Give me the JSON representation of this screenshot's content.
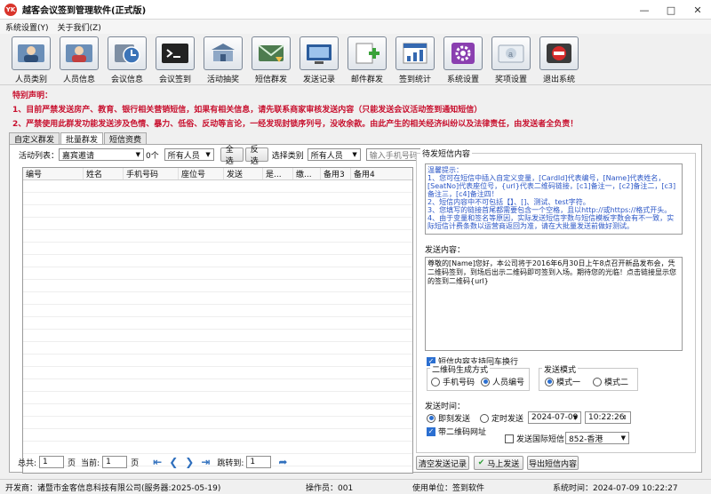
{
  "app": {
    "title": "越客会议签到管理软件(正式版)",
    "badge": "YK"
  },
  "menu": [
    "系统设置(Y)",
    "关于我们(Z)"
  ],
  "toolbar": [
    {
      "label": "人员类别",
      "icon": "people-category-icon"
    },
    {
      "label": "人员信息",
      "icon": "person-info-icon"
    },
    {
      "label": "会议信息",
      "icon": "meeting-history-icon"
    },
    {
      "label": "会议签到",
      "icon": "terminal-signin-icon"
    },
    {
      "label": "活动抽奖",
      "icon": "lottery-icon"
    },
    {
      "label": "短信群发",
      "icon": "sms-broadcast-icon"
    },
    {
      "label": "发送记录",
      "icon": "send-record-icon"
    },
    {
      "label": "邮件群发",
      "icon": "email-broadcast-icon"
    },
    {
      "label": "签到统计",
      "icon": "statistics-icon"
    },
    {
      "label": "系统设置",
      "icon": "gear-icon"
    },
    {
      "label": "奖项设置",
      "icon": "award-icon"
    },
    {
      "label": "退出系统",
      "icon": "exit-icon"
    }
  ],
  "notice": {
    "heading": "特别声明：",
    "line1": "1、目前严禁发送房产、教育、银行相关营销短信，如果有相关信息，请先联系商家审核发送内容（只能发送会议活动签到通知短信）",
    "line2": "2、严禁使用此群发功能发送涉及色情、暴力、低俗、反动等言论，一经发现封锁序列号，没收余款。由此产生的相关经济纠纷以及法律责任，由发送者全负责！"
  },
  "tabs": [
    "自定义群发",
    "批量群发",
    "短信资费"
  ],
  "active_tab": 1,
  "filters": {
    "activity_label": "活动列表：",
    "activity_value": "嘉宾邀请",
    "count_suffix": "0个",
    "people_value": "所有人员",
    "select_all": "全选",
    "invert": "反选",
    "category_label": "选择类别",
    "category_value": "所有人员",
    "phone_placeholder": "输入手机号码"
  },
  "table": {
    "columns": [
      "编号",
      "姓名",
      "手机号码",
      "座位号",
      "发送",
      "是...",
      "缴...",
      "备用3",
      "备用4"
    ]
  },
  "pager": {
    "total_label": "总共:",
    "total_value": "1",
    "page_unit": "页",
    "current_label": "当前:",
    "current_value": "1",
    "page_unit2": "页",
    "jump_label": "跳转到:",
    "jump_value": "1"
  },
  "sms": {
    "frame_title": "待发短信内容",
    "tips": [
      "温馨提示：",
      "1、您可在短信中插入自定义变量，[CardId]代表编号，[Name]代表姓名，[SeatNo]代表座位号，{url}代表二维码链接，[c1]备注一，[c2]备注二，[c3]备注三，[c4]备注四！",
      "2、短信内容中不可包括【】、[]、测试、test字符。",
      "3、您填写的链接首尾都需要包含一个空格，且以http://或https://格式开头。",
      "4、由于变量和签名等原因，实际发送短信字数与短信模板字数会有不一致，实际短信计费条数以运营商返回为准，请在大批量发送前做好测试。"
    ],
    "content_label": "发送内容：",
    "content": "尊敬的[Name]您好，本公司将于2016年6月30日上午8点召开新品发布会，凭二维码签到，到场后出示二维码即可签到入场。期待您的光临！点击链接显示您的签到二维码{url}",
    "newline_label": "短信内容支持回车换行",
    "qr_group_title": "二维码生成方式",
    "qr_option1": "手机号码",
    "qr_option2": "人员编号",
    "mode_group_title": "发送模式",
    "mode_option1": "模式一",
    "mode_option2": "模式二",
    "time_label": "发送时间：",
    "send_now": "即刻发送",
    "send_timed": "定时发送",
    "date_value": "2024-07-09",
    "time_value": "10:22:26",
    "with_qr": "带二维码网址",
    "intl_label": "发送国际短信",
    "region_value": "852-香港"
  },
  "actions": {
    "clear": "清空发送记录",
    "send": "马上发送",
    "export": "导出短信内容"
  },
  "status": {
    "developer": "开发商：诸暨市金客信息科技有限公司(服务器:2025-05-19)",
    "operator": "操作员：001",
    "unit": "使用单位：签到软件",
    "systime": "系统时间：2024-07-09 10:22:27"
  }
}
